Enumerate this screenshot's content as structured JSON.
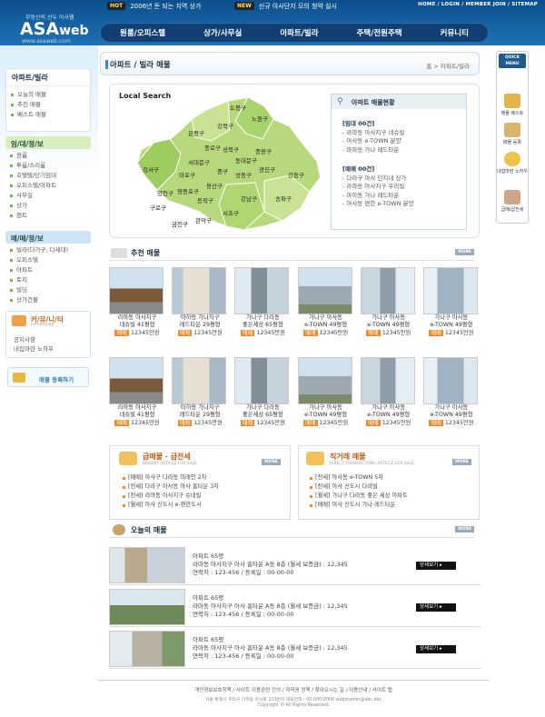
{
  "header": {
    "logo_small": "부동산의 선두 아사웹",
    "logo_main": "ASA",
    "logo_web": "web",
    "logo_url": "www.asaweb.com",
    "ticker1_badge": "HOT",
    "ticker1_text": "2006년 돈 되는 지역 상가",
    "ticker2_badge": "NEW",
    "ticker2_text": "신규 아사단지 모의 청약 실시",
    "toplinks": "HOME / LOGIN / MEMBER JOIN / SITEMAP",
    "nav": [
      "원룸/오피스텔",
      "상가/사무실",
      "아파트/빌라",
      "주택/전원주택",
      "커뮤니티"
    ]
  },
  "sidebar": {
    "section1_title": "아파트/빌라",
    "section1_items": [
      "오늘의 매물",
      "추천 매물",
      "베스트 매물"
    ],
    "section2_title": "임/대/정/보",
    "section2_items": [
      "원룸",
      "투룸/스리룸",
      "호텔텔/단기임대",
      "오피스텔/아파트",
      "사무실",
      "상가",
      "렌트"
    ],
    "section3_title": "매/매/정/보",
    "section3_items": [
      "빌라(다가구, 다세대)",
      "오피스텔",
      "아파트",
      "토지",
      "빌딩",
      "상가건물"
    ],
    "community_title": "커/뮤/니/티",
    "community_sub": "community",
    "community_items": [
      "공지사항",
      "내집마련 노하우"
    ],
    "register_label": "매물 등록하기"
  },
  "main": {
    "page_title": "아파트 / 빌라 매물",
    "breadcrumb": "홈 > 아파트/빌라",
    "local_search": "Local Search",
    "districts": [
      "도봉구",
      "노원구",
      "강북구",
      "은평구",
      "성북구",
      "중랑구",
      "종로구",
      "동대문구",
      "서대문구",
      "중구",
      "광진구",
      "강서구",
      "마포구",
      "성동구",
      "강동구",
      "용산구",
      "양천구",
      "영등포구",
      "동작구",
      "송파구",
      "구로구",
      "관악구",
      "서초구",
      "강남구",
      "금천구"
    ],
    "status_title": "아파트 매물현황",
    "status_lease_head": "[임대 00건]",
    "status_lease_items": [
      "- 라마동 아사지구 네슈빌",
      "- 아사동 e-TOWN 분양",
      "- 마하동 가나 레드타운"
    ],
    "status_sale_head": "[매매 00건]",
    "status_sale_items": [
      "- 다라구 아사 단지내 상가",
      "- 라마동 아사지구 우리빌",
      "- 마하동 가나 레드타운",
      "- 아사동 편한 e-TOWN 분양"
    ],
    "recommend_title": "추천 매물",
    "more_label": "MORE",
    "price_badge": "매매",
    "cards": [
      {
        "t1": "라마동 아사지구",
        "t2": "네슈빌 41평형",
        "price": "12345만원"
      },
      {
        "t1": "마하동 가나지구",
        "t2": "레드타운 29평형",
        "price": "12345만원"
      },
      {
        "t1": "가나구 다라동",
        "t2": "좋은세상 65평형",
        "price": "12345만원"
      },
      {
        "t1": "가나구 아사동",
        "t2": "e-TOWN 49평형",
        "price": "12345만원"
      },
      {
        "t1": "가나구 아사동",
        "t2": "e-TOWN 49평형",
        "price": "12345만원"
      },
      {
        "t1": "가나구 아사동",
        "t2": "e-TOWN 49평형",
        "price": "12345만원"
      },
      {
        "t1": "라마동 아사지구",
        "t2": "네슈빌 41평형",
        "price": "12345만원"
      },
      {
        "t1": "마하동 가나지구",
        "t2": "레드타운 29평형",
        "price": "12345만원"
      },
      {
        "t1": "가나구 다라동",
        "t2": "좋은세상 65평형",
        "price": "12345만원"
      },
      {
        "t1": "가나구 아사동",
        "t2": "e-TOWN 49평형",
        "price": "12345만원"
      },
      {
        "t1": "가나구 아사동",
        "t2": "e-TOWN 49평형",
        "price": "12345만원"
      },
      {
        "t1": "가나구 아사동",
        "t2": "e-TOWN 49평형",
        "price": "12345만원"
      }
    ],
    "urgent_title": "급매물 · 급전세",
    "urgent_sub": "URGENT ARTICLE FOR SALE",
    "urgent_items": [
      "[매매] 아사구 다라동 미래안 2차",
      "[전세] 다라구 아사동 아사 홈타운 3차",
      "[전세] 라마동 아사지구 슈네빌",
      "[월세] 아사 신도시 e-편한도시"
    ],
    "direct_title": "직거래 매물",
    "direct_sub": "DIRECT TRANSACTIONS ARTICLE FOR SALE",
    "direct_items": [
      "[전세] 아사동 e-TOWN 5차",
      "[전세] 아사 신도시 다라빌",
      "[월세] 가나구 다라동 좋은 세상 아파트",
      "[매매] 아사 신도시 가나 레드타운"
    ],
    "today_title": "오늘의 매물",
    "today_rows": [
      {
        "l1": "아파트 65평",
        "l2": "라마동 아사지구 아사 홈타운 A동 8층 (월세 보증금) : 12,345",
        "l3": "연락처 : 123-456   /   등록일 : 00-00-00",
        "btn": "상세보기"
      },
      {
        "l1": "아파트 65평",
        "l2": "라마동 아사지구 아사 홈타운 A동 8층 (월세 보증금) : 12,345",
        "l3": "연락처 : 123-456   /   등록일 : 00-00-00",
        "btn": "상세보기"
      },
      {
        "l1": "아파트 65평",
        "l2": "라마동 아사지구 아사 홈타운 A동 8층 (월세 보증금) : 12,345",
        "l3": "연락처 : 123-456   /   등록일 : 00-00-00",
        "btn": "상세보기"
      }
    ]
  },
  "quick": {
    "head": "QUICK MENU",
    "items": [
      "매물 베스트",
      "매물 등록",
      "내집마련 노하우",
      "급매/급전세"
    ]
  },
  "footer": {
    "links": "개인정보보호정책  /  사이트 이용관련 건의  /  저작권 정책  /  찾아오시는 길  /  이용안내  /  사이트 맵",
    "address": "서울 특별시 우리구 다라동 아사로 123번지   대표전화 : 00-000-0000   webmaster@abc.abc",
    "copyright": "Copyright © All Rights Reserved."
  }
}
